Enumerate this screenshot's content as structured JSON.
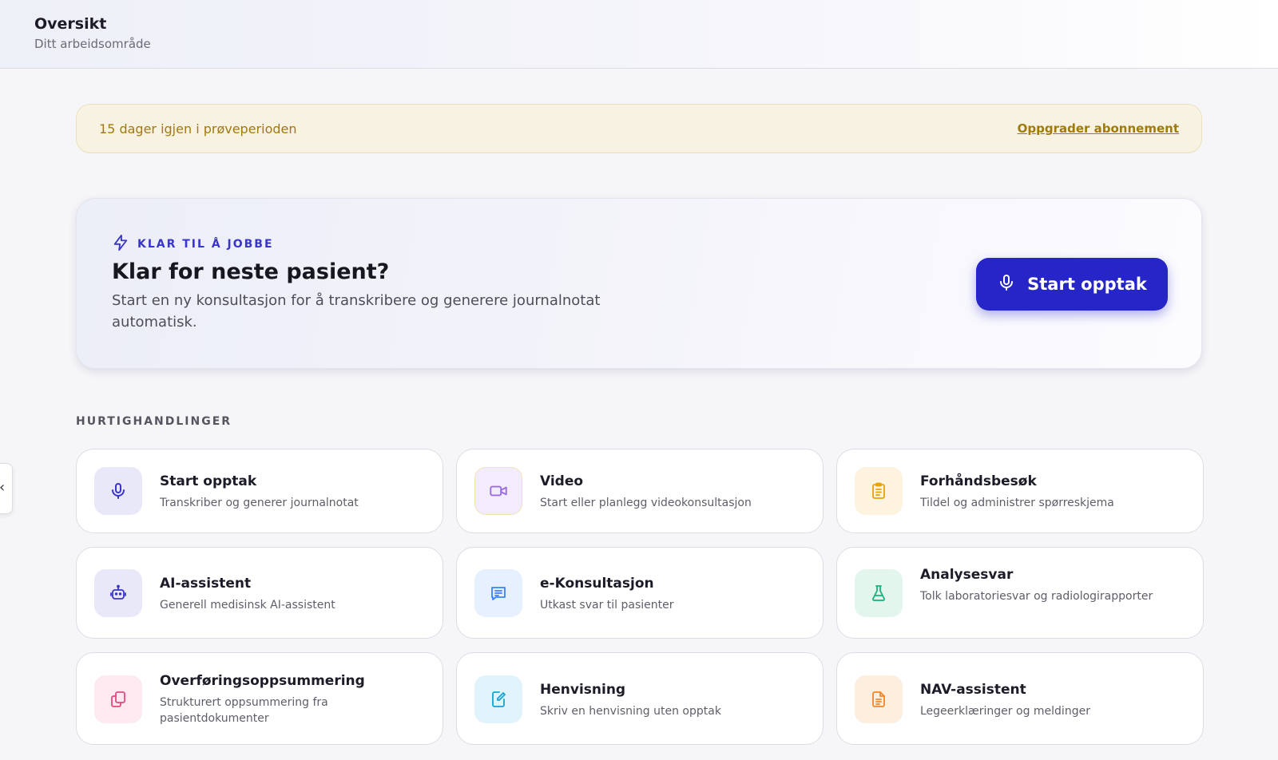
{
  "header": {
    "title": "Oversikt",
    "subtitle": "Ditt arbeidsområde"
  },
  "trial": {
    "message": "15 dager igjen i prøveperioden",
    "upgrade_label": "Oppgrader abonnement"
  },
  "hero": {
    "eyebrow": "KLAR TIL Å JOBBE",
    "heading": "Klar for neste pasient?",
    "description": "Start en ny konsultasjon for å transkribere og generere journalnotat automatisk.",
    "button_label": "Start opptak"
  },
  "quick_actions": {
    "title": "HURTIGHANDLINGER",
    "items": [
      {
        "title": "Start opptak",
        "desc": "Transkriber og generer journalnotat",
        "icon": "microphone-icon",
        "accent": "#3a35c9",
        "bg": "#e8e8f8"
      },
      {
        "title": "Video",
        "desc": "Start eller planlegg videokonsultasjon",
        "icon": "video-camera-icon",
        "accent": "#9b6fe0",
        "bg": "#f3ecfd"
      },
      {
        "title": "Forhåndsbesøk",
        "desc": "Tildel og administrer spørreskjema",
        "icon": "clipboard-list-icon",
        "accent": "#e8a20b",
        "bg": "#fdf3df"
      },
      {
        "title": "AI-assistent",
        "desc": "Generell medisinsk AI-assistent",
        "icon": "robot-icon",
        "accent": "#3a35c9",
        "bg": "#e8e8f8"
      },
      {
        "title": "e-Konsultasjon",
        "desc": "Utkast svar til pasienter",
        "icon": "chat-message-icon",
        "accent": "#3b82f6",
        "bg": "#e6f0fe"
      },
      {
        "title": "Analysesvar",
        "desc": "Tolk laboratoriesvar og radiologirapporter",
        "icon": "flask-icon",
        "accent": "#19b27a",
        "bg": "#e2f6ee"
      },
      {
        "title": "Overføringsoppsummering",
        "desc": "Strukturert oppsummering fra pasientdokumenter",
        "icon": "documents-copy-icon",
        "accent": "#e5487a",
        "bg": "#fde9ef"
      },
      {
        "title": "Henvisning",
        "desc": "Skriv en henvisning uten opptak",
        "icon": "file-edit-icon",
        "accent": "#0ea5d6",
        "bg": "#e1f4fb"
      },
      {
        "title": "NAV-assistent",
        "desc": "Legeerklæringer og meldinger",
        "icon": "document-text-icon",
        "accent": "#f0862a",
        "bg": "#fdeedd"
      }
    ]
  },
  "side_toggle": {
    "glyph": "‹"
  }
}
